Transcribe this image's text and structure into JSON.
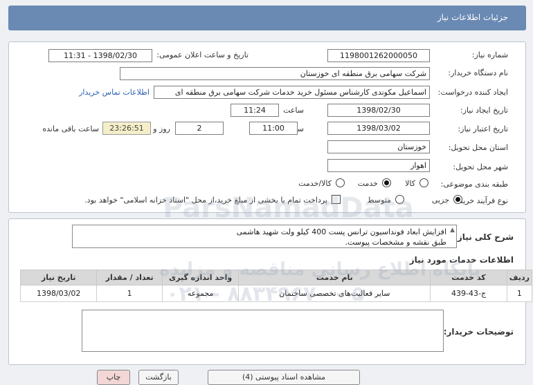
{
  "header": {
    "title": "جزئیات اطلاعات نیاز"
  },
  "fields": {
    "need_number_label": "شماره نیاز:",
    "need_number": "1198001262000050",
    "announce_label": "تاریخ و ساعت اعلان عمومی:",
    "announce_value": "1398/02/30 - 11:31",
    "buyer_org_label": "نام دستگاه خریدار:",
    "buyer_org": "شرکت سهامی برق منطقه ای خوزستان",
    "creator_label": "ایجاد کننده درخواست:",
    "creator": "اسماعیل مکوندی کارشناس مسئول خرید خدمات شرکت سهامی برق منطقه ای",
    "contact_link": "اطلاعات تماس خریدار",
    "created_date_label": "تاریخ ایجاد نیاز:",
    "created_date": "1398/02/30",
    "time_word": "ساعت",
    "created_time": "11:24",
    "valid_date_label": "تاریخ اعتبار نیاز:",
    "valid_date": "1398/03/02",
    "valid_time": "11:00",
    "days": "2",
    "days_word": "روز و",
    "remaining": "23:26:51",
    "remaining_word": "ساعت باقی مانده",
    "province_label": "استان محل تحویل:",
    "province": "خوزستان",
    "city_label": "شهر محل تحویل:",
    "city": "اهواز",
    "category_label": "طبقه بندی موضوعی:",
    "category_options": [
      "کالا",
      "خدمت",
      "کالا/خدمت"
    ],
    "category_selected": "خدمت",
    "process_label": "نوع فرآیند خرید :",
    "process_options": [
      "جزیی",
      "متوسط"
    ],
    "process_selected": "جزیی",
    "payment_note": "پرداخت تمام یا بخشی از مبلغ خرید،از محل \"اسناد خزانه اسلامی\" خواهد بود."
  },
  "summary": {
    "label": "شرح کلی نیاز:",
    "line1": "افزایش ابعاد فونداسیون ترانس پست 400 کیلو ولت شهید هاشمی",
    "line2": "طبق نقشه و مشخصات پیوست."
  },
  "services": {
    "title": "اطلاعات خدمات مورد نیاز",
    "columns": [
      "ردیف",
      "کد خدمت",
      "نام خدمت",
      "واحد اندازه گیری",
      "تعداد / مقدار",
      "تاریخ نیاز"
    ],
    "rows": [
      [
        "1",
        "ج-43-439",
        "سایر فعالیت‌های تخصصی ساختمان",
        "مجموعه",
        "1",
        "1398/03/02"
      ]
    ]
  },
  "buyer_notes": {
    "label": "توضیحات خریدار:",
    "value": ""
  },
  "watermarks": {
    "brand": "ParsNamadData",
    "line1": "پایگاه اطلاع رسانی مناقصه و مزایده",
    "line2": "۰۲۱ - ۸۸۳۴۹۶۷۰ - ۵"
  },
  "footer": {
    "buttons": [
      "مشاهده اسناد پیوستی (4)",
      "بازگشت",
      "چاپ"
    ]
  }
}
